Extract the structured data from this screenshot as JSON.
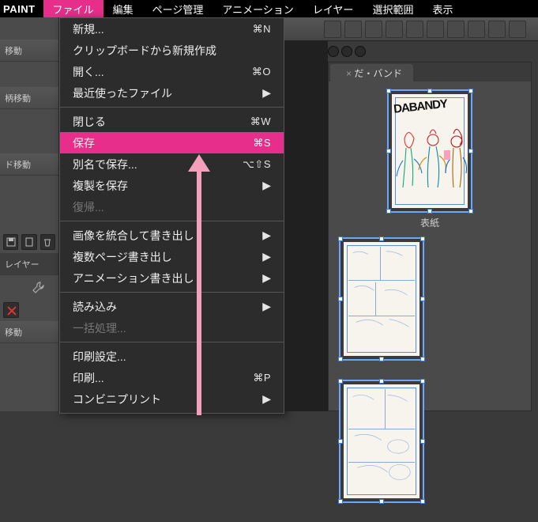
{
  "menubar": {
    "appname": "PAINT",
    "items": [
      "ファイル",
      "編集",
      "ページ管理",
      "アニメーション",
      "レイヤー",
      "選択範囲",
      "表示"
    ],
    "active_index": 0
  },
  "dropdown": {
    "groups": [
      [
        {
          "label": "新規...",
          "shortcut": "⌘N",
          "enabled": true
        },
        {
          "label": "クリップボードから新規作成",
          "enabled": true
        },
        {
          "label": "開く...",
          "shortcut": "⌘O",
          "enabled": true
        },
        {
          "label": "最近使ったファイル",
          "submenu": true,
          "enabled": true
        }
      ],
      [
        {
          "label": "閉じる",
          "shortcut": "⌘W",
          "enabled": true
        },
        {
          "label": "保存",
          "shortcut": "⌘S",
          "enabled": true,
          "highlight": true
        },
        {
          "label": "別名で保存...",
          "shortcut": "⌥⇧S",
          "enabled": true
        },
        {
          "label": "複製を保存",
          "submenu": true,
          "enabled": true
        },
        {
          "label": "復帰...",
          "enabled": false
        }
      ],
      [
        {
          "label": "画像を統合して書き出し",
          "submenu": true,
          "enabled": true
        },
        {
          "label": "複数ページ書き出し",
          "submenu": true,
          "enabled": true
        },
        {
          "label": "アニメーション書き出し",
          "submenu": true,
          "enabled": true
        }
      ],
      [
        {
          "label": "読み込み",
          "submenu": true,
          "enabled": true
        },
        {
          "label": "一括処理...",
          "enabled": false
        }
      ],
      [
        {
          "label": "印刷設定...",
          "enabled": true
        },
        {
          "label": "印刷...",
          "shortcut": "⌘P",
          "enabled": true
        },
        {
          "label": "コンビニプリント",
          "submenu": true,
          "enabled": true
        }
      ]
    ]
  },
  "left_tools": {
    "rows": [
      "移動",
      "柄移動",
      "ド移動",
      "レイヤー",
      "",
      "移動"
    ]
  },
  "page_panel": {
    "tab_label": "だ・バンド",
    "cover_caption": "表紙",
    "cover_title": "DABANDY"
  }
}
